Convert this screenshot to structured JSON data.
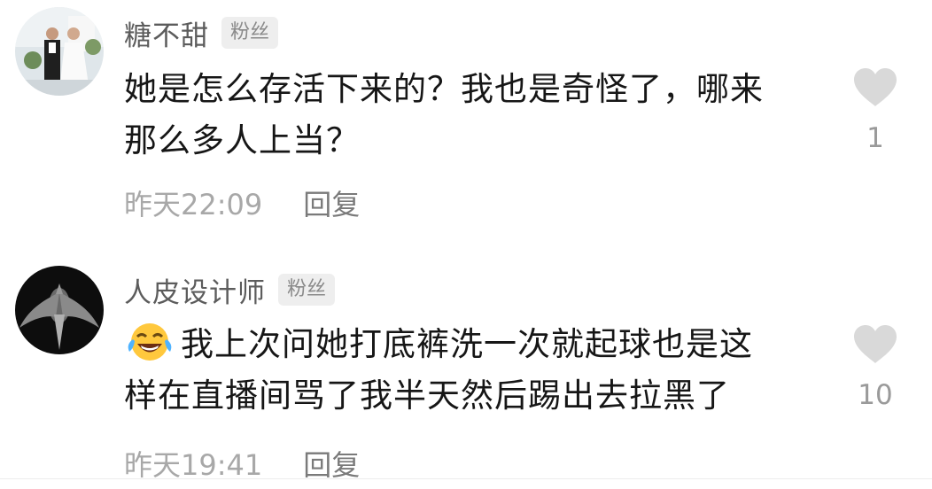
{
  "comments": [
    {
      "username": "糖不甜",
      "badge": "粉丝",
      "lines": [
        "她是怎么存活下来的？我也是奇怪了，哪来",
        "那么多人上当？"
      ],
      "time": "昨天22:09",
      "reply_label": "回复",
      "like_count": "1",
      "avatar": "wedding-photo-avatar"
    },
    {
      "username": "人皮设计师",
      "badge": "粉丝",
      "emoji": "laughing-with-tears-emoji",
      "lines": [
        "我上次问她打底裤洗一次就起球也是这",
        "样在直播间骂了我半天然后踢出去拉黑了"
      ],
      "time": "昨天19:41",
      "reply_label": "回复",
      "like_count": "10",
      "avatar": "dark-figure-avatar"
    }
  ],
  "colors": {
    "username": "#5c5c5c",
    "body_text": "#161616",
    "meta_text": "#a8a8a8",
    "badge_bg": "#eeeeee",
    "like_icon": "#d9d9d9"
  }
}
